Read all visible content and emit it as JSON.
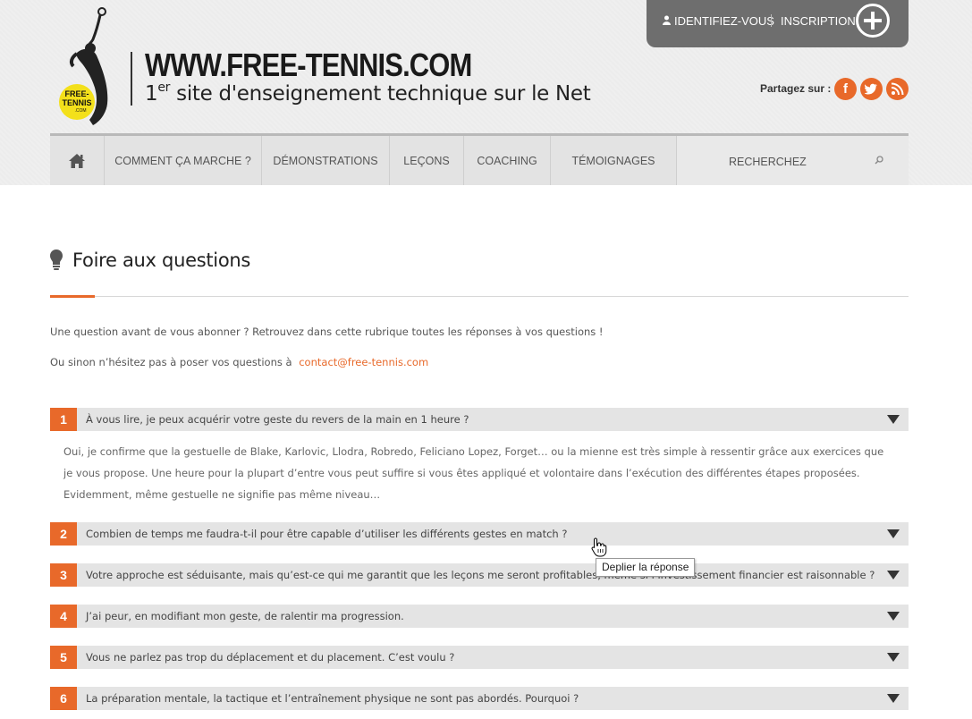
{
  "header": {
    "site_title": "WWW.FREE-TENNIS.COM",
    "tagline_num": "1",
    "tagline_sup": "er",
    "tagline_rest": " site d'enseignement technique sur le Net",
    "logo_text_1": "FREE-",
    "logo_text_2": "TENNIS",
    "logo_text_3": ".COM"
  },
  "account": {
    "login_label": "IDENTIFIEZ-VOUS",
    "register_label": "INSCRIPTION"
  },
  "share": {
    "label": "Partagez sur :",
    "facebook": "f"
  },
  "nav": {
    "items": [
      "COMMENT ÇA MARCHE ?",
      "DÉMONSTRATIONS",
      "LEÇONS",
      "COACHING",
      "TÉMOIGNAGES"
    ],
    "search_placeholder": "RECHERCHEZ"
  },
  "main": {
    "title": "Foire aux questions",
    "intro_1": "Une question avant de vous abonner ? Retrouvez dans cette rubrique toutes les réponses à vos questions !",
    "intro_2": "Ou sinon n’hésitez pas à poser vos questions à",
    "contact_email": "contact@free-tennis.com"
  },
  "faq": [
    {
      "num": "1",
      "question": "À vous lire, je peux acquérir votre geste du revers de la main en 1 heure ?",
      "answer": "Oui, je confirme que la gestuelle de Blake, Karlovic, Llodra, Robredo, Feliciano Lopez, Forget… ou la mienne est très simple à ressentir grâce aux exercices que je vous propose. Une heure pour la plupart d’entre vous peut suffire si vous êtes appliqué et volontaire dans l’exécution des différentes étapes proposées. Evidemment, même gestuelle ne signifie pas même niveau…"
    },
    {
      "num": "2",
      "question": "Combien de temps me faudra-t-il pour être capable d’utiliser les différents gestes en match ?"
    },
    {
      "num": "3",
      "question": "Votre approche est séduisante, mais qu’est-ce qui me garantit que les leçons me seront profitables, même si l’investissement financier est raisonnable ?"
    },
    {
      "num": "4",
      "question": "J’ai peur, en modifiant mon geste, de ralentir ma progression."
    },
    {
      "num": "5",
      "question": "Vous ne parlez pas trop du déplacement et du placement. C’est voulu ?"
    },
    {
      "num": "6",
      "question": "La préparation mentale, la tactique et l’entraînement physique ne sont pas abordés. Pourquoi ?"
    }
  ],
  "tooltip": "Deplier la réponse",
  "colors": {
    "accent": "#e8692a",
    "header_bg": "#efefef",
    "nav_bg": "#e3e3e3",
    "faq_row_bg": "#e4e4e4",
    "account_bg": "#6e6e6e"
  }
}
